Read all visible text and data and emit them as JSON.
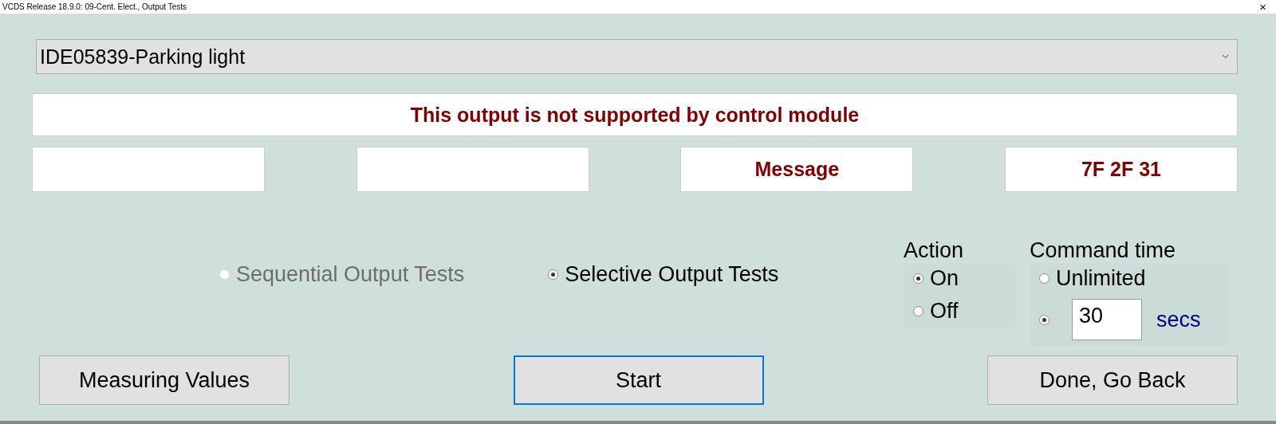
{
  "window": {
    "title": "VCDS Release 18.9.0: 09-Cent. Elect.,  Output Tests",
    "close": "×"
  },
  "output_select": {
    "value": "IDE05839-Parking light"
  },
  "message": "This output is not supported by control module",
  "info_boxes": [
    {
      "kind": "blank"
    },
    {
      "kind": "blank"
    },
    {
      "kind": "text",
      "text": "Message"
    },
    {
      "kind": "text",
      "text": "7F 2F 31"
    }
  ],
  "test_modes": [
    {
      "label": "Sequential Output Tests",
      "selected": false,
      "disabled": true
    },
    {
      "label": "Selective Output Tests",
      "selected": true,
      "disabled": false
    }
  ],
  "action": {
    "title": "Action",
    "options": [
      {
        "label": "On",
        "selected": true
      },
      {
        "label": "Off",
        "selected": false
      }
    ]
  },
  "command_time": {
    "title": "Command time",
    "options": [
      {
        "kind": "label",
        "label": "Unlimited",
        "selected": false
      },
      {
        "kind": "field",
        "value": "30",
        "unit": "secs",
        "selected": true
      }
    ]
  },
  "buttons": [
    {
      "label": "Measuring Values",
      "focused": false
    },
    {
      "label": "Start",
      "focused": true
    },
    {
      "label": "Done, Go Back",
      "focused": false
    }
  ]
}
